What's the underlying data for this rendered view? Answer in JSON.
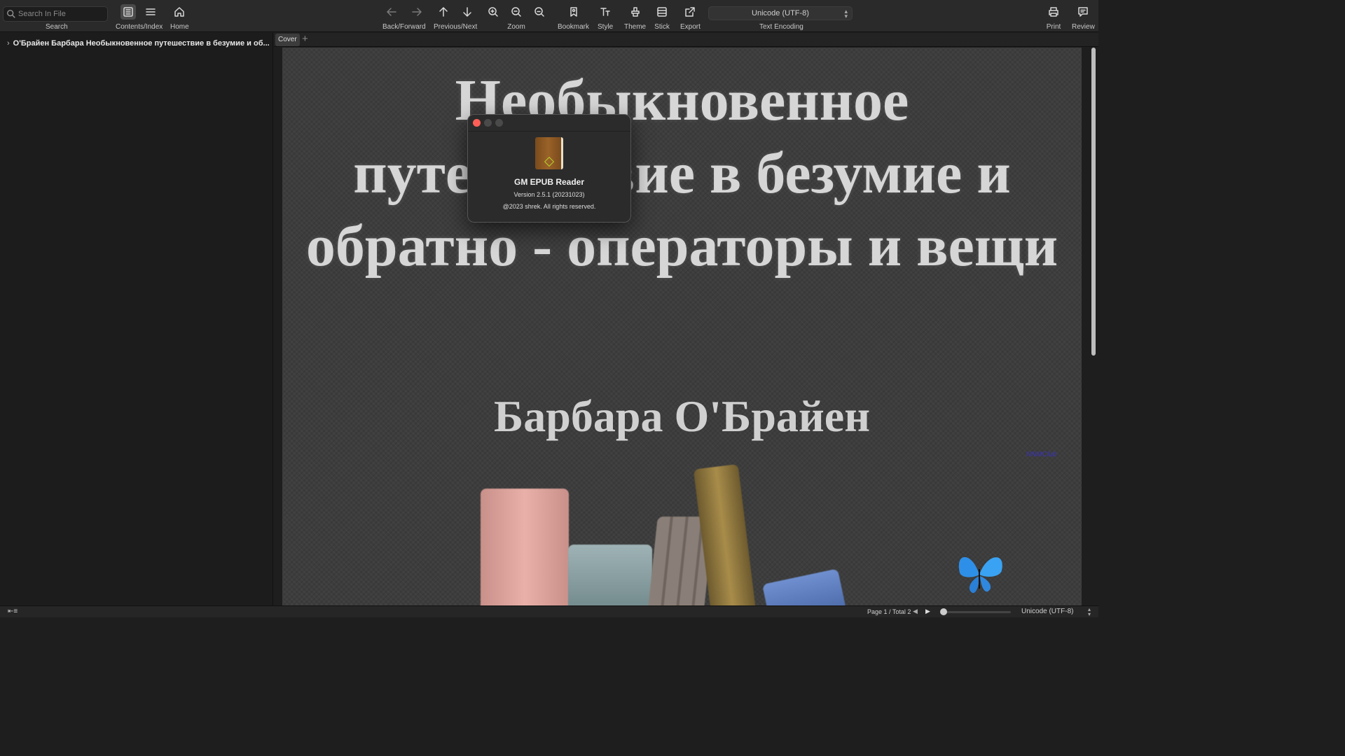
{
  "toolbar": {
    "search_placeholder": "Search In File",
    "search_label": "Search",
    "contents_label": "Contents/Index",
    "home_label": "Home",
    "backforward_label": "Back/Forward",
    "prevnext_label": "Previous/Next",
    "zoom_label": "Zoom",
    "bookmark_label": "Bookmark",
    "style_label": "Style",
    "theme_label": "Theme",
    "stick_label": "Stick",
    "export_label": "Export",
    "encoding_value": "Unicode  (UTF-8)",
    "encoding_label": "Text Encoding",
    "print_label": "Print",
    "review_label": "Review"
  },
  "sidebar": {
    "items": [
      {
        "label": "О'Брайен Барбара Необыкновенное путешествие в безумие и об..."
      }
    ]
  },
  "tabs": [
    {
      "label": "Cover"
    }
  ],
  "tab_add": "+",
  "book": {
    "title": "Необыкновенное путешествие в безумие и обратно - операторы и вещи",
    "author": "Барбара О'Брайен",
    "watermark": "NNMClub"
  },
  "about": {
    "app_name": "GM EPUB Reader",
    "version": "Version 2.5.1 (20231023)",
    "copyright": "@2023 shrek. All rights reserved."
  },
  "status": {
    "page": "Page 1 / Total 2",
    "encoding": "Unicode  (UTF-8)"
  },
  "colors": {
    "close": "#ff5f57",
    "minimize": "#4a4a4a",
    "zoom": "#4a4a4a",
    "accent": "#4aa3ff"
  }
}
